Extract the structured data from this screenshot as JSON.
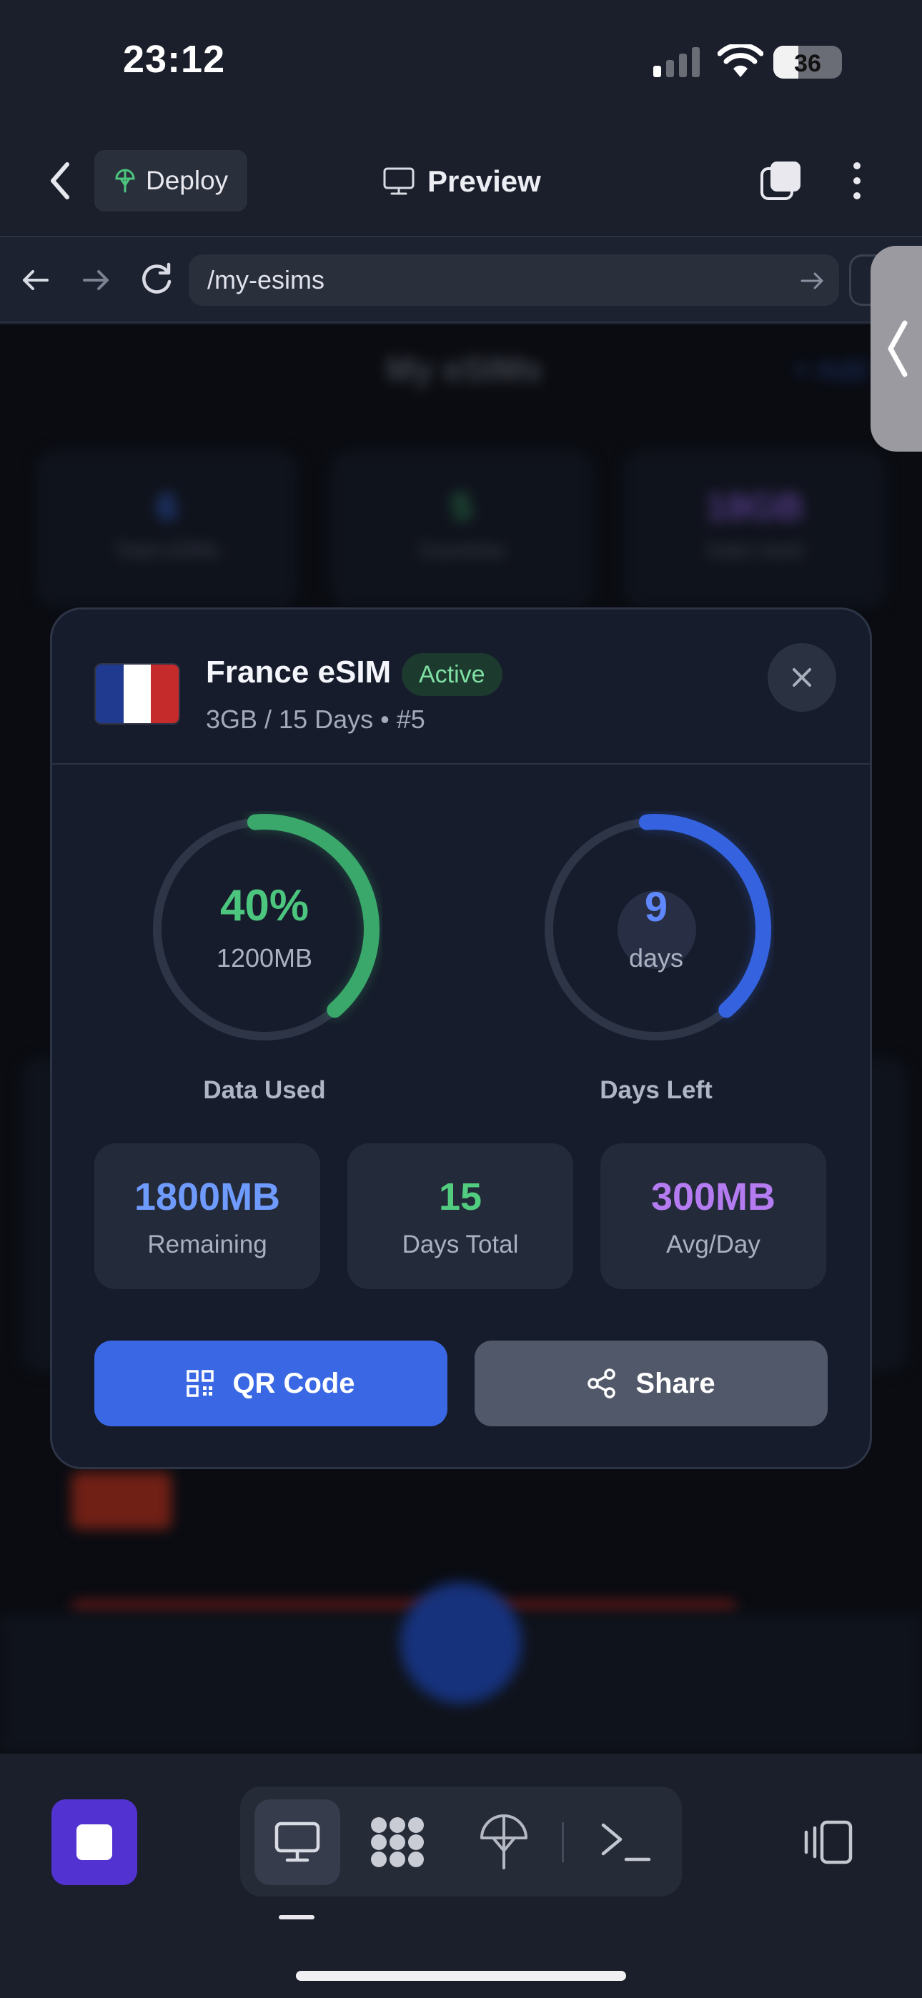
{
  "status_bar": {
    "time": "23:12",
    "battery": "36"
  },
  "header": {
    "deploy_label": "Deploy",
    "preview_label": "Preview"
  },
  "browser": {
    "url": "/my-esims"
  },
  "background": {
    "page_title": "My eSIMs",
    "add_label": "+ Add",
    "stats": [
      {
        "value": "6",
        "label": "Total eSIMs",
        "color": "#3b6ff0"
      },
      {
        "value": "5",
        "label": "Countries",
        "color": "#3ea96a"
      },
      {
        "value": "18GB",
        "label": "Data Used",
        "color": "#8f62e6"
      }
    ]
  },
  "modal": {
    "title": "France eSIM",
    "badge": "Active",
    "subtitle": "3GB / 15 Days • #5",
    "flag_colors": [
      "#1f3a8f",
      "#ffffff",
      "#c62b2b"
    ],
    "data_ring": {
      "percent": 0.4,
      "value": "40%",
      "sub": "1200MB",
      "label": "Data Used",
      "color": "#3aa86a"
    },
    "days_ring": {
      "percent": 0.4,
      "value": "9",
      "sub": "days",
      "label": "Days Left",
      "color": "#3563e0"
    },
    "stats": [
      {
        "value": "1800MB",
        "label": "Remaining",
        "color": "#6f9bff"
      },
      {
        "value": "15",
        "label": "Days Total",
        "color": "#52cd7f"
      },
      {
        "value": "300MB",
        "label": "Avg/Day",
        "color": "#b57cf2"
      }
    ],
    "qr_button": "QR Code",
    "share_button": "Share"
  },
  "toolbar": {
    "icons": [
      "stop-icon",
      "desktop-icon",
      "flower-icon",
      "deploy-icon",
      "terminal-icon",
      "layout-icon"
    ]
  }
}
